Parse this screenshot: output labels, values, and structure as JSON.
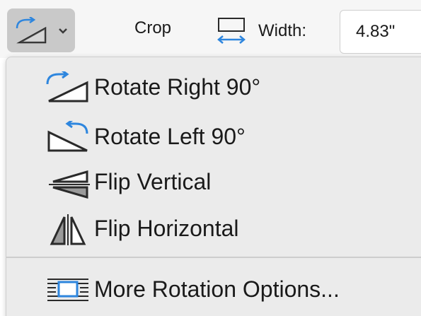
{
  "toolbar": {
    "rotate_icon": "rotate-right-icon",
    "chevron_icon": "chevron-down-icon",
    "crop_label": "Crop",
    "width_icon": "width-icon",
    "width_label": "Width:",
    "width_value": "4.83\""
  },
  "menu": {
    "items": [
      {
        "label": "Rotate Right 90°",
        "icon": "rotate-right-icon"
      },
      {
        "label": "Rotate Left 90°",
        "icon": "rotate-left-icon"
      },
      {
        "label": "Flip Vertical",
        "icon": "flip-vertical-icon"
      },
      {
        "label": "Flip Horizontal",
        "icon": "flip-horizontal-icon"
      },
      {
        "label": "More Rotation Options...",
        "icon": "rotation-options-icon"
      }
    ]
  },
  "colors": {
    "accent": "#2e86de",
    "toolbar_bg": "#f6f6f6",
    "menu_bg": "#ebebeb",
    "button_active": "#c9c9c9"
  }
}
